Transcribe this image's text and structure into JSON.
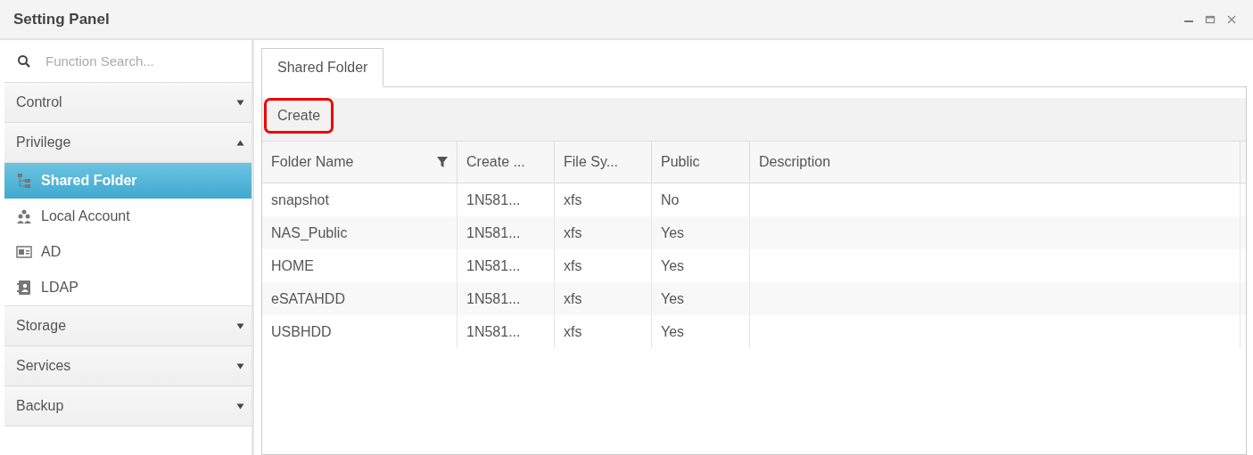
{
  "window": {
    "title": "Setting Panel"
  },
  "sidebar": {
    "search": {
      "placeholder": "Function Search..."
    },
    "groups": [
      {
        "label": "Control",
        "expanded": false
      },
      {
        "label": "Privilege",
        "expanded": true,
        "children": [
          {
            "label": "Shared Folder",
            "selected": true
          },
          {
            "label": "Local Account",
            "selected": false
          },
          {
            "label": "AD",
            "selected": false
          },
          {
            "label": "LDAP",
            "selected": false
          }
        ]
      },
      {
        "label": "Storage",
        "expanded": false
      },
      {
        "label": "Services",
        "expanded": false
      },
      {
        "label": "Backup",
        "expanded": false
      }
    ]
  },
  "tabs": [
    {
      "label": "Shared Folder",
      "selected": true
    }
  ],
  "toolbar": {
    "create_button": "Create"
  },
  "table": {
    "columns": [
      {
        "label": "Folder Name",
        "filter": true
      },
      {
        "label": "Create ...",
        "filter": false
      },
      {
        "label": "File Sy...",
        "filter": false
      },
      {
        "label": "Public",
        "filter": false
      },
      {
        "label": "Description",
        "filter": false
      }
    ],
    "rows": [
      [
        "snapshot",
        "1N581...",
        "xfs",
        "No",
        ""
      ],
      [
        "NAS_Public",
        "1N581...",
        "xfs",
        "Yes",
        ""
      ],
      [
        "HOME",
        "1N581...",
        "xfs",
        "Yes",
        ""
      ],
      [
        "eSATAHDD",
        "1N581...",
        "xfs",
        "Yes",
        ""
      ],
      [
        "USBHDD",
        "1N581...",
        "xfs",
        "Yes",
        ""
      ]
    ]
  }
}
